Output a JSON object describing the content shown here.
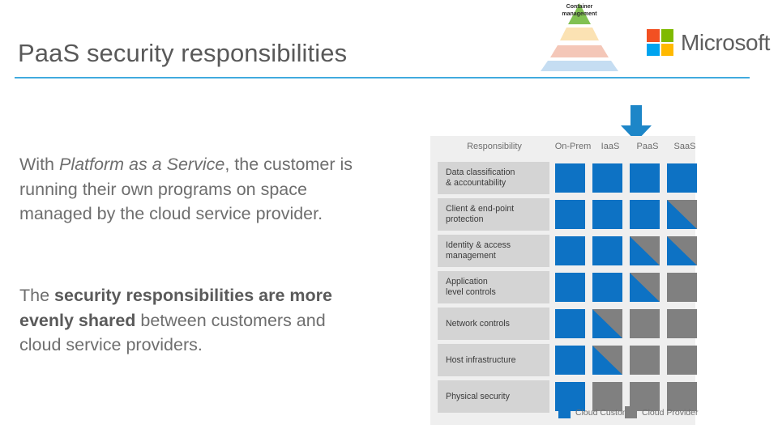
{
  "slide": {
    "title": "PaaS security responsibilities",
    "accent_color": "#41AADE"
  },
  "brand": {
    "name": "Microsoft",
    "logo_colors": {
      "top_left": "#F25022",
      "top_right": "#7FBA00",
      "bottom_left": "#00A4EF",
      "bottom_right": "#FFB900"
    }
  },
  "pyramid": {
    "label": "Container management",
    "layers": [
      {
        "name": "top-layer",
        "color": "#76BC43"
      },
      {
        "name": "second-layer",
        "color": "#FBE2B3"
      },
      {
        "name": "third-layer",
        "color": "#F4C7B8"
      },
      {
        "name": "base-layer",
        "color": "#C5DDF2"
      }
    ]
  },
  "body": {
    "paragraph_1": {
      "lead": "With ",
      "emphasis": "Platform as a Service",
      "tail": ", the customer is running their own programs on space managed by the cloud service provider."
    },
    "paragraph_2": {
      "lead": "The ",
      "strong": "security responsibilities are more evenly shared",
      "tail": " between customers and cloud service providers."
    }
  },
  "arrow": {
    "name": "paas-column-pointer",
    "direction": "down",
    "color": "#1D86C8",
    "points_to": "PaaS"
  },
  "matrix": {
    "columns": [
      "Responsibility",
      "On-Prem",
      "IaaS",
      "PaaS",
      "SaaS"
    ],
    "rows": [
      {
        "label": "Data classification\n& accountability",
        "cells": [
          "full",
          "full",
          "full",
          "full"
        ]
      },
      {
        "label": "Client & end-point\nprotection",
        "cells": [
          "full",
          "full",
          "full",
          "split"
        ]
      },
      {
        "label": "Identity & access\nmanagement",
        "cells": [
          "full",
          "full",
          "split",
          "split"
        ]
      },
      {
        "label": "Application\nlevel controls",
        "cells": [
          "full",
          "full",
          "split",
          "gray"
        ]
      },
      {
        "label": "Network controls",
        "cells": [
          "full",
          "split",
          "gray",
          "gray"
        ]
      },
      {
        "label": "Host infrastructure",
        "cells": [
          "full",
          "split",
          "gray",
          "gray"
        ]
      },
      {
        "label": "Physical security",
        "cells": [
          "full",
          "gray",
          "gray",
          "gray"
        ]
      }
    ],
    "legend": [
      {
        "label": "Cloud Customer",
        "color": "#0D72C4"
      },
      {
        "label": "Cloud Provider",
        "color": "#808080"
      }
    ],
    "cell_colors": {
      "customer": "#0D72C4",
      "provider": "#808080",
      "label_background": "#D4D4D4",
      "panel_background": "#EFEFEF"
    }
  }
}
